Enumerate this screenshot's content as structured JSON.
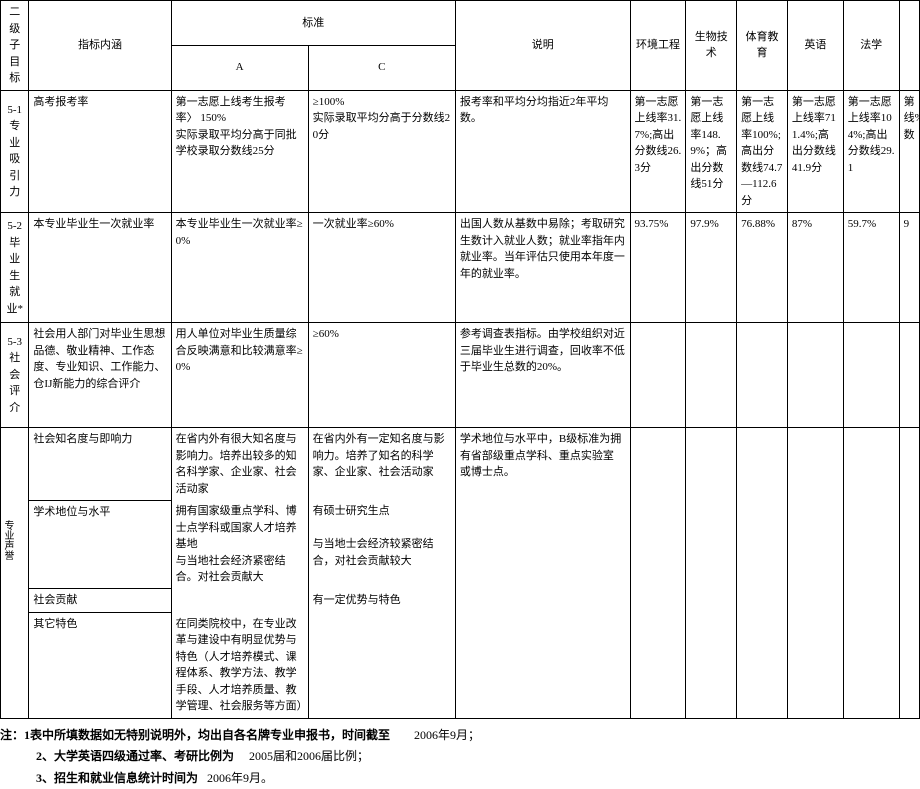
{
  "side_label": "专业声誉",
  "headers": {
    "col_idx": "二级子目标",
    "col_meaning": "指标内涵",
    "col_standard": "标准",
    "col_std_a": "A",
    "col_std_c": "C",
    "col_desc": "说明",
    "col_m1": "环境工程",
    "col_m2": "生物技术",
    "col_m3": "体育教育",
    "col_m4": "英语",
    "col_m5": "法学",
    "col_m6": ""
  },
  "rows": {
    "r1": {
      "idx": "5-1 专业吸引力",
      "meaning": "高考报考率",
      "std_a": "第一志愿上线考生报考率〉 150%\n实际录取平均分高于同批学校录取分数线25分",
      "std_c": "≥100%\n实际录取平均分高于分数线20分",
      "desc": "报考率和平均分均指近2年平均数。",
      "m1": "第一志愿上线率31.7%;高出分数线26.3分",
      "m2": "第一志愿上线率148.9%；高出分数线51分",
      "m3": "第一志愿上线率100%;高出分数线74.7 —112.6分",
      "m4": "第一志愿上线率711.4%;高出分数线41.9分",
      "m5": "第一志愿上线率104%;高出分数线29.1",
      "m6": "第线%;数"
    },
    "r2": {
      "idx": "5-2 毕业生就业*",
      "meaning": "本专业毕业生一次就业率",
      "std_a": "本专业毕业生一次就业率≥0%",
      "std_c": "一次就业率≥60%",
      "desc": "出国人数从基数中易除；考取研究生数计入就业人数；就业率指年内就业率。当年评估只使用本年度一年的就业率。",
      "m1": "93.75%",
      "m2": "97.9%",
      "m3": "76.88%",
      "m4": "87%",
      "m5": "59.7%",
      "m6": "9"
    },
    "r3": {
      "idx": "5-3 社会评介",
      "meaning": "社会用人部门对毕业生思想品德、敬业精神、工作态度、专业知识、工作能力、仓IJ新能力的综合评介",
      "std_a": "用人单位对毕业生质量综合反映满意和比较满意率≥0%",
      "std_c": "≥60%",
      "desc": "参考调查表指标。由学校组织对近三届毕业生进行调查，回收率不低于毕业生总数的20%。",
      "m1": "",
      "m2": "",
      "m3": "",
      "m4": "",
      "m5": "",
      "m6": ""
    },
    "r4a": {
      "meaning": "社会知名度与即响力",
      "std_a": "在省内外有很大知名度与影响力。培养出较多的知名科学家、企业家、社会活动家",
      "std_c": "在省内外有一定知名度与影响力。培养了知名的科学家、企业家、社会活动家",
      "desc": "学术地位与水平中，B级标准为拥有省部级重点学科、重点实验室 或博士点。"
    },
    "r4b": {
      "meaning": "学术地位与水平",
      "std_a": "拥有国家级重点学科、博士点学科或国家人才培养基地\n与当地社会经济紧密结合。对社会贡献大",
      "std_c": "有硕士研究生点\n\n与当地士会经济较紧密结合，对社会贡献较大"
    },
    "r4c": {
      "meaning": "社会贡献"
    },
    "r4d": {
      "meaning": "其它特色",
      "std_a": "在同类院校中，在专业改革与建设中有明显优势与特色（人才培养模式、课程体系、教学方法、教学手段、人才培养质量、教学管理、社会服务等方面）",
      "std_c": "有一定优势与特色"
    }
  },
  "notes": {
    "n1a": "注：1表中所填数据如无特别说明外，均出自各名牌专业申报书，时间截至",
    "n1b": "2006年9月；",
    "n2a": "2、大学英语四级通过率、考研比例为",
    "n2b": "2005届和2006届比例；",
    "n3a": "3、招生和就业信息统计时间为",
    "n3b": "2006年9月。"
  }
}
